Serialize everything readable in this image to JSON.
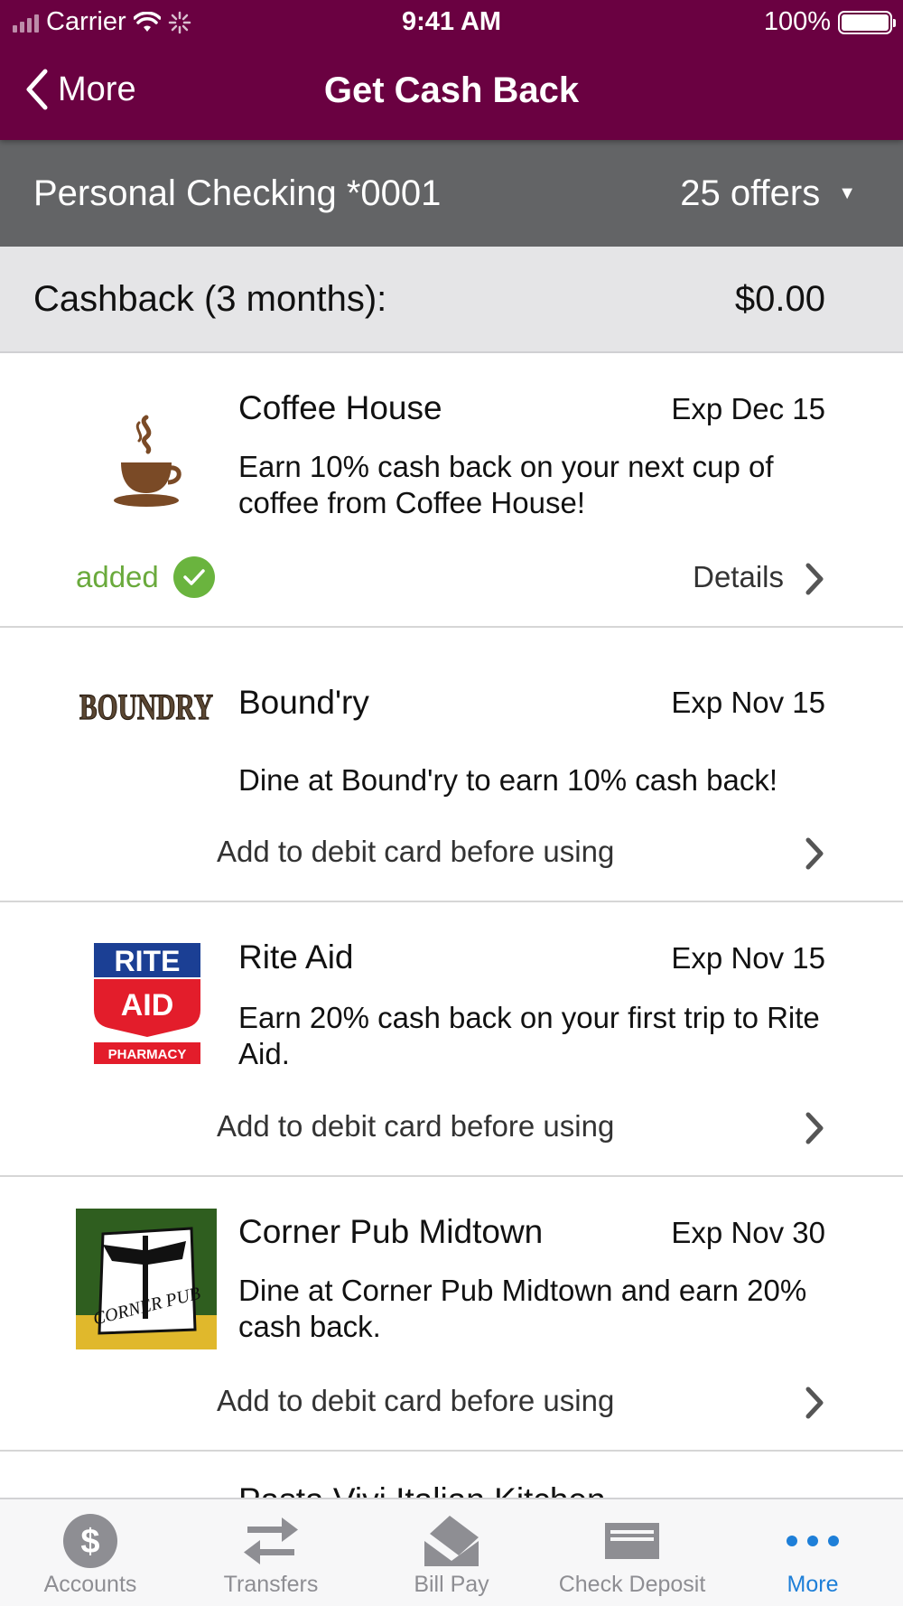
{
  "status_bar": {
    "carrier": "Carrier",
    "time": "9:41 AM",
    "battery": "100%"
  },
  "nav": {
    "back_label": "More",
    "title": "Get Cash Back"
  },
  "account": {
    "name": "Personal Checking *0001",
    "offers_label": "25 offers"
  },
  "cashback": {
    "label": "Cashback (3 months):",
    "amount": "$0.00"
  },
  "offers": [
    {
      "merchant": "Coffee House",
      "exp": "Exp Dec 15",
      "desc": "Earn 10% cash back on your next cup of coffee from Coffee House!",
      "status": "added",
      "action": "Details"
    },
    {
      "merchant": "Bound'ry",
      "exp": "Exp Nov 15",
      "desc": "Dine at Bound'ry to earn 10% cash back!",
      "action": "Add to debit card before using",
      "logo_text": "BOUNDRY"
    },
    {
      "merchant": "Rite Aid",
      "exp": "Exp Nov 15",
      "desc": "Earn 20% cash back on your first trip to Rite Aid.",
      "action": "Add to debit card before using",
      "logo_line1": "RITE",
      "logo_line2": "AID",
      "logo_line3": "PHARMACY"
    },
    {
      "merchant": "Corner Pub Midtown",
      "exp": "Exp Nov 30",
      "desc": "Dine at Corner Pub Midtown and earn 20% cash back.",
      "action": "Add to debit card before using",
      "logo_text": "CORNER PUB"
    }
  ],
  "peek_text": "Pasta Vivi Italian Kitchen",
  "tabs": [
    {
      "label": "Accounts",
      "icon": "dollar-circle-icon"
    },
    {
      "label": "Transfers",
      "icon": "transfer-arrows-icon"
    },
    {
      "label": "Bill Pay",
      "icon": "envelope-icon"
    },
    {
      "label": "Check Deposit",
      "icon": "check-icon"
    },
    {
      "label": "More",
      "icon": "ellipsis-icon"
    }
  ],
  "colors": {
    "brand": "#6a0141",
    "account_bar": "#636466",
    "added_green": "#6ab43e",
    "active_tab": "#1e7fd8",
    "inactive_tab": "#8e8e93"
  }
}
